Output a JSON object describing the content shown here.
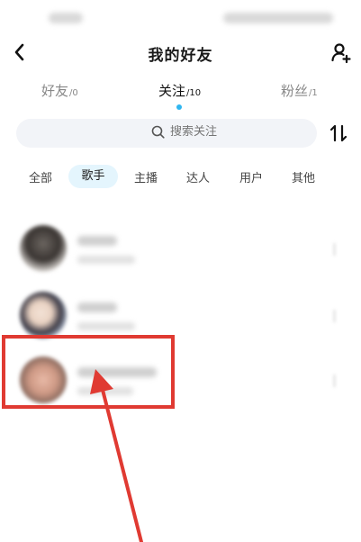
{
  "header": {
    "title": "我的好友"
  },
  "tabs": [
    {
      "label": "好友",
      "count": "/0",
      "active": false
    },
    {
      "label": "关注",
      "count": "/10",
      "active": true
    },
    {
      "label": "粉丝",
      "count": "/1",
      "active": false
    }
  ],
  "search": {
    "placeholder": "搜索关注"
  },
  "categories": [
    {
      "label": "全部",
      "selected": false
    },
    {
      "label": "歌手",
      "selected": true
    },
    {
      "label": "主播",
      "selected": false
    },
    {
      "label": "达人",
      "selected": false
    },
    {
      "label": "用户",
      "selected": false
    },
    {
      "label": "其他",
      "selected": false
    }
  ],
  "colors": {
    "accent": "#2fb6f0",
    "selected_chip": "#e4f5fd",
    "annotation_red": "#e03a32"
  },
  "icons": {
    "back": "chevron-left-icon",
    "add_user": "add-user-icon",
    "search": "search-icon",
    "sort": "sort-icon"
  },
  "highlighted_row": 3
}
